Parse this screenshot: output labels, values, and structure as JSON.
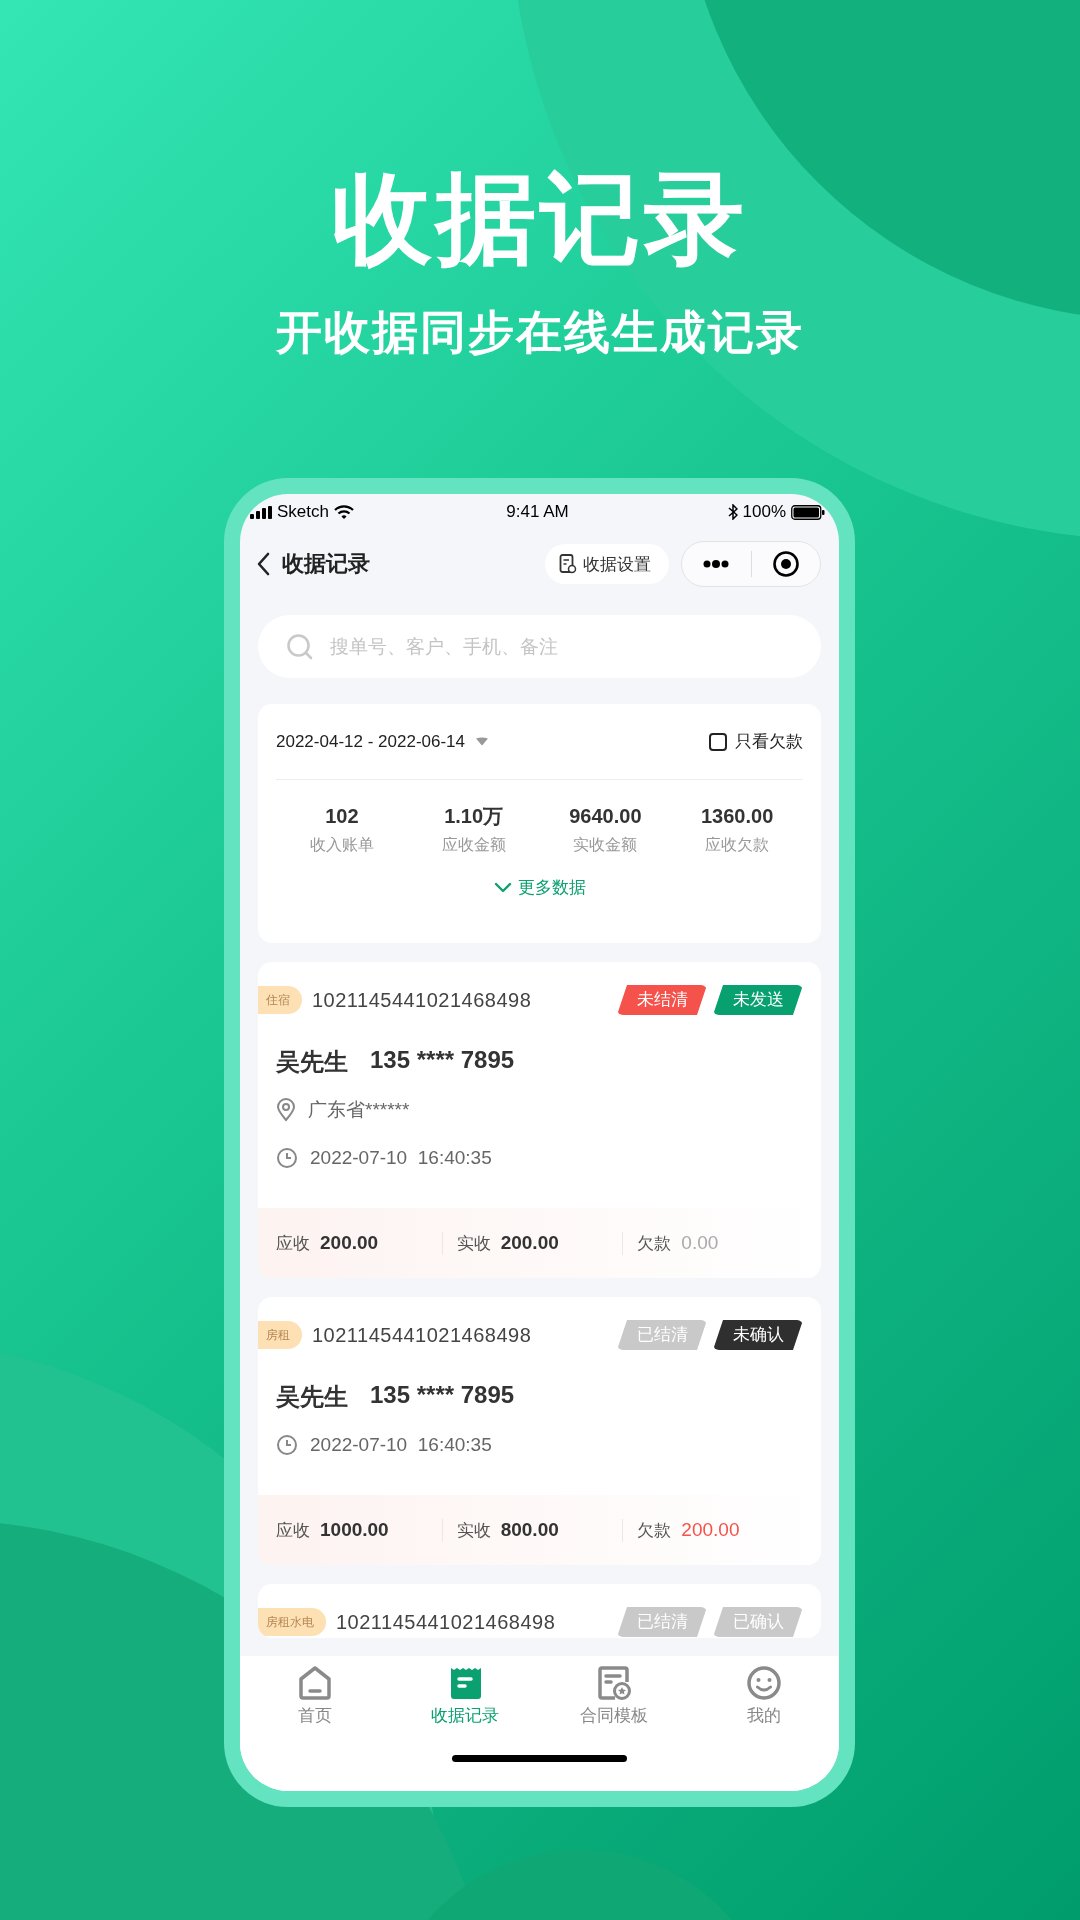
{
  "headline": {
    "title": "收据记录",
    "subtitle": "开收据同步在线生成记录"
  },
  "status_bar": {
    "carrier": "Sketch",
    "time": "9:41 AM",
    "battery": "100%"
  },
  "nav": {
    "title": "收据记录",
    "settings_button": "收据设置"
  },
  "search": {
    "placeholder": "搜单号、客户、手机、备注"
  },
  "summary": {
    "date_range": "2022-04-12 - 2022-06-14",
    "only_arrears": {
      "label": "只看欠款",
      "checked": false
    },
    "stats": [
      {
        "value": "102",
        "label": "收入账单"
      },
      {
        "value": "1.10万",
        "label": "应收金额"
      },
      {
        "value": "9640.00",
        "label": "实收金额"
      },
      {
        "value": "1360.00",
        "label": "应收欠款"
      }
    ],
    "more": "更多数据"
  },
  "receipts": [
    {
      "category": "住宿",
      "number": "1021145441021468498",
      "tags": [
        {
          "label": "未结清",
          "color": "#f5524b"
        },
        {
          "label": "未发送",
          "color": "#08a06e"
        }
      ],
      "customer": "吴先生",
      "phone": "135 **** 7895",
      "address": "广东省******",
      "time": "2022-07-10  16:40:35",
      "amounts": [
        {
          "label": "应收",
          "value": "200.00",
          "kind": "plain"
        },
        {
          "label": "实收",
          "value": "200.00",
          "kind": "plain"
        },
        {
          "label": "欠款",
          "value": "0.00",
          "kind": "muted"
        }
      ]
    },
    {
      "category": "房租",
      "number": "1021145441021468498",
      "tags": [
        {
          "label": "已结清",
          "color": "#c9c9c9"
        },
        {
          "label": "未确认",
          "color": "#2f2f2f"
        }
      ],
      "customer": "吴先生",
      "phone": "135 **** 7895",
      "time": "2022-07-10  16:40:35",
      "amounts": [
        {
          "label": "应收",
          "value": "1000.00",
          "kind": "plain"
        },
        {
          "label": "实收",
          "value": "800.00",
          "kind": "plain"
        },
        {
          "label": "欠款",
          "value": "200.00",
          "kind": "alert"
        }
      ]
    },
    {
      "category": "房租水电",
      "number": "1021145441021468498",
      "tags": [
        {
          "label": "已结清",
          "color": "#c9c9c9"
        },
        {
          "label": "已确认",
          "color": "#c9c9c9"
        }
      ]
    }
  ],
  "tab_bar": [
    {
      "label": "首页",
      "selected": false
    },
    {
      "label": "收据记录",
      "selected": true
    },
    {
      "label": "合同模板",
      "selected": false
    },
    {
      "label": "我的",
      "selected": false
    }
  ]
}
